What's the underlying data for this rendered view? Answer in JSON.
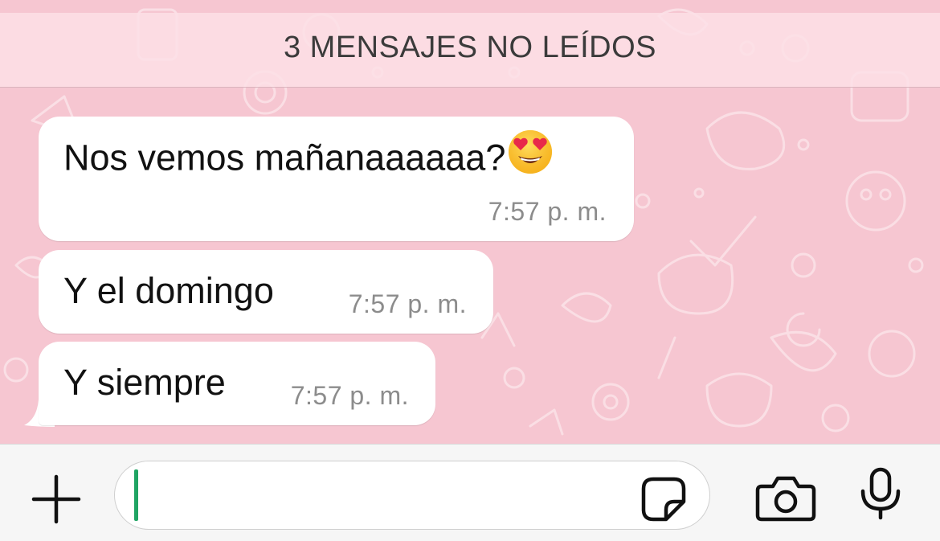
{
  "banner": {
    "text": "3 MENSAJES NO LEÍDOS"
  },
  "messages": [
    {
      "text": "Nos vemos mañanaaaaaa?",
      "emoji": "heart-eyes-emoji",
      "time": "7:57 p. m."
    },
    {
      "text": "Y el domingo",
      "time": "7:57 p. m."
    },
    {
      "text": "Y siempre",
      "time": "7:57 p. m."
    }
  ],
  "composer": {
    "value": "",
    "icons": {
      "attach": "plus-icon",
      "sticker": "sticker-icon",
      "camera": "camera-icon",
      "mic": "microphone-icon"
    },
    "caret_color": "#1fa463"
  },
  "colors": {
    "wallpaper": "#f6c6d1",
    "bubble": "#ffffff",
    "timestamp": "#8c8c8c"
  }
}
